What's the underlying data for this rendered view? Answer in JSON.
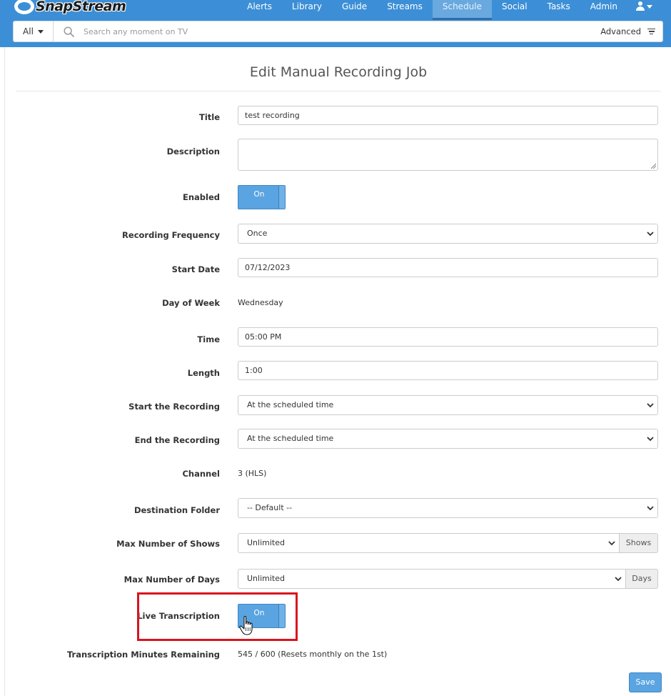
{
  "brand": {
    "name": "SnapStream"
  },
  "nav": {
    "items": [
      "Alerts",
      "Library",
      "Guide",
      "Streams",
      "Schedule",
      "Social",
      "Tasks",
      "Admin"
    ],
    "active": "Schedule"
  },
  "search": {
    "scope": "All",
    "placeholder": "Search any moment on TV",
    "advanced_label": "Advanced"
  },
  "page": {
    "title": "Edit Manual Recording Job"
  },
  "form": {
    "title": {
      "label": "Title",
      "value": "test recording"
    },
    "description": {
      "label": "Description",
      "value": ""
    },
    "enabled": {
      "label": "Enabled",
      "state": "On"
    },
    "recording_frequency": {
      "label": "Recording Frequency",
      "value": "Once"
    },
    "start_date": {
      "label": "Start Date",
      "value": "07/12/2023"
    },
    "day_of_week": {
      "label": "Day of Week",
      "value": "Wednesday"
    },
    "time": {
      "label": "Time",
      "value": "05:00 PM"
    },
    "length": {
      "label": "Length",
      "value": "1:00"
    },
    "start_recording": {
      "label": "Start the Recording",
      "value": "At the scheduled time"
    },
    "end_recording": {
      "label": "End the Recording",
      "value": "At the scheduled time"
    },
    "channel": {
      "label": "Channel",
      "value": "3 (HLS)"
    },
    "destination_folder": {
      "label": "Destination Folder",
      "value": "-- Default --"
    },
    "max_shows": {
      "label": "Max Number of Shows",
      "value": "Unlimited",
      "unit": "Shows"
    },
    "max_days": {
      "label": "Max Number of Days",
      "value": "Unlimited",
      "unit": "Days"
    },
    "live_transcription": {
      "label": "Live Transcription",
      "state": "On"
    },
    "transcription_minutes": {
      "label": "Transcription Minutes Remaining",
      "value": "545 / 600 (Resets monthly on the 1st)"
    }
  },
  "actions": {
    "save_label": "Save"
  },
  "colors": {
    "header": "#3c8fd6",
    "accent": "#5aa4e1",
    "highlight": "#d9141e"
  }
}
